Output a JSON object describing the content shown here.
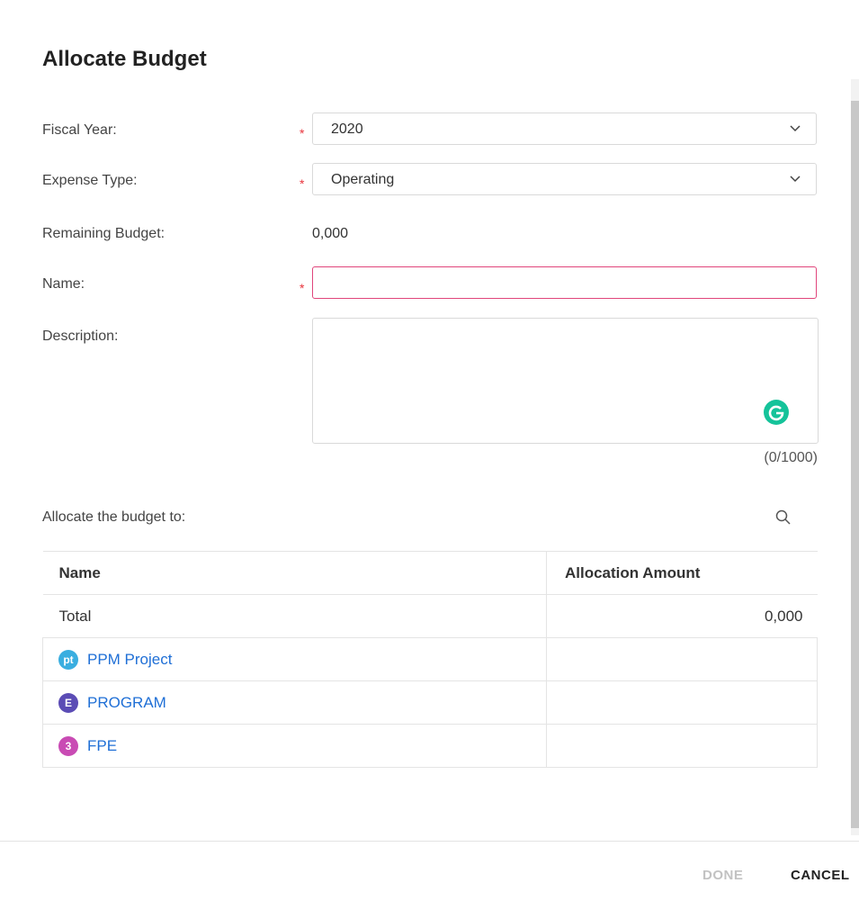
{
  "dialog": {
    "title": "Allocate Budget"
  },
  "form": {
    "fiscal_year_label": "Fiscal Year:",
    "fiscal_year_value": "2020",
    "expense_type_label": "Expense Type:",
    "expense_type_value": "Operating",
    "remaining_budget_label": "Remaining Budget:",
    "remaining_budget_value": "0,000",
    "name_label": "Name:",
    "name_value": "",
    "description_label": "Description:",
    "description_value": "",
    "description_count": "(0/1000)",
    "required_marker": "*"
  },
  "allocation": {
    "label": "Allocate the budget to:",
    "columns": {
      "name": "Name",
      "amount": "Allocation Amount"
    },
    "total": {
      "name": "Total",
      "amount": "0,000"
    },
    "items": [
      {
        "badge": "pt",
        "badge_color": "#3aaee0",
        "name": "PPM Project",
        "amount": ""
      },
      {
        "badge": "E",
        "badge_color": "#5b4cb5",
        "name": "PROGRAM",
        "amount": ""
      },
      {
        "badge": "3",
        "badge_color": "#c94bb4",
        "name": "FPE",
        "amount": ""
      }
    ]
  },
  "footer": {
    "done_label": "DONE",
    "cancel_label": "CANCEL"
  },
  "icons": {
    "search": "search-icon",
    "chevron": "chevron-down-icon",
    "grammarly": "grammarly-icon"
  }
}
